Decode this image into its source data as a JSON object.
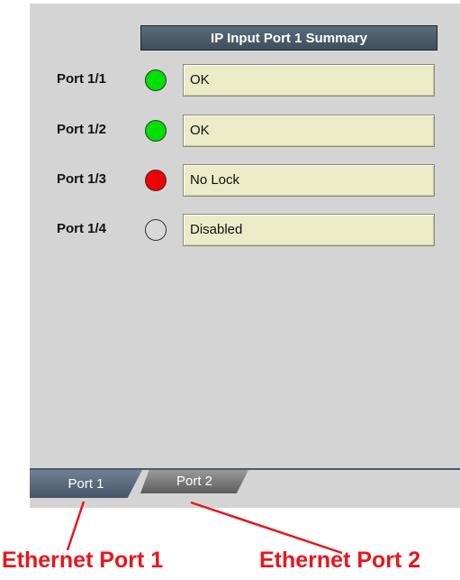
{
  "summary": {
    "title": "IP Input Port 1 Summary"
  },
  "ports": [
    {
      "label": "Port 1/1",
      "status": "OK",
      "led_color": "#00e000"
    },
    {
      "label": "Port 1/2",
      "status": "OK",
      "led_color": "#00e000"
    },
    {
      "label": "Port 1/3",
      "status": "No Lock",
      "led_color": "#f00000"
    },
    {
      "label": "Port 1/4",
      "status": "Disabled",
      "led_color": "#d8d8d8"
    }
  ],
  "tabs": [
    {
      "label": "Port 1",
      "active": true
    },
    {
      "label": "Port 2",
      "active": false
    }
  ],
  "callouts": {
    "ethernet_port_1": "Ethernet Port 1",
    "ethernet_port_2": "Ethernet Port 2",
    "color": "#e8161e"
  }
}
